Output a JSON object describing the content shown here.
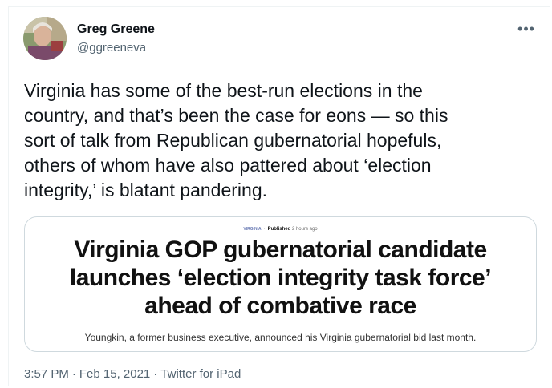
{
  "author": {
    "name": "Greg Greene",
    "handle": "@ggreeneva"
  },
  "tweet": {
    "lines": [
      "Virginia has some of the best-run elections in the",
      "country, and that’s been the case for eons — so this",
      "sort of talk from Republican gubernatorial hopefuls,",
      "others of whom have also pattered about ‘election",
      "integrity,’ is blatant pandering."
    ]
  },
  "card": {
    "section": "VIRGINIA",
    "published_label": "Published",
    "published_time": "2 hours ago",
    "headline_lines": [
      "Virginia GOP gubernatorial candidate",
      "launches ‘election integrity task force’",
      "ahead of combative race"
    ],
    "subtitle": "Youngkin, a former business executive, announced his Virginia gubernatorial bid last month."
  },
  "meta": {
    "time": "3:57 PM",
    "date": "Feb 15, 2021",
    "source": "Twitter for iPad",
    "separator": "·"
  },
  "more_label": "•••",
  "icons": {
    "more": "more-options-icon",
    "avatar": "profile-photo"
  }
}
